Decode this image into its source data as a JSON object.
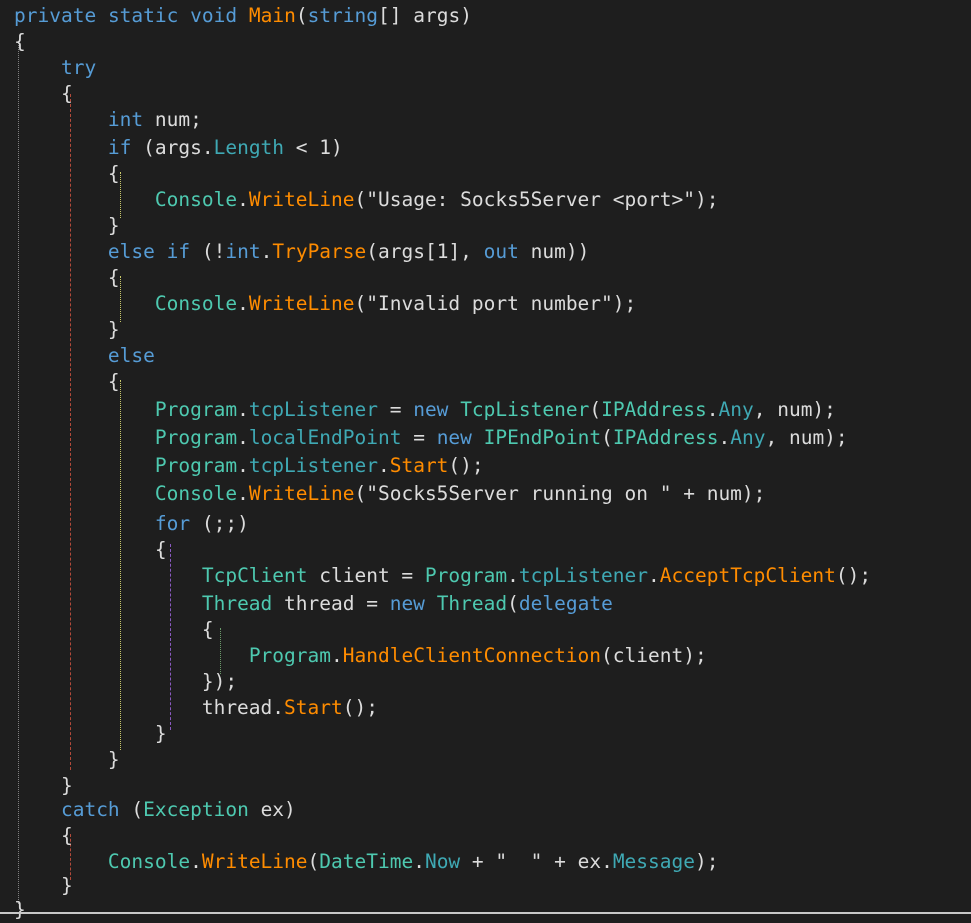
{
  "colors": {
    "background": "#1e1e1e",
    "keyword": "#569cd6",
    "type": "#4ec9b0",
    "method": "#ff8c00",
    "string": "#d69d85",
    "property": "#3fa9b4",
    "text": "#dcdcdc"
  },
  "code": {
    "lines": [
      [
        {
          "t": "private",
          "c": "kw"
        },
        {
          "t": " ",
          "c": "plain"
        },
        {
          "t": "static",
          "c": "kw"
        },
        {
          "t": " ",
          "c": "plain"
        },
        {
          "t": "void",
          "c": "kw"
        },
        {
          "t": " ",
          "c": "plain"
        },
        {
          "t": "Main",
          "c": "fn"
        },
        {
          "t": "(",
          "c": "plain"
        },
        {
          "t": "string",
          "c": "kw"
        },
        {
          "t": "[] args)",
          "c": "plain"
        }
      ],
      [
        {
          "t": "{",
          "c": "plain"
        }
      ],
      [
        {
          "t": "    ",
          "c": "plain"
        },
        {
          "t": "try",
          "c": "kw"
        }
      ],
      [
        {
          "t": "    {",
          "c": "plain"
        }
      ],
      [
        {
          "t": "        ",
          "c": "plain"
        },
        {
          "t": "int",
          "c": "kw"
        },
        {
          "t": " num;",
          "c": "plain"
        }
      ],
      [
        {
          "t": "        ",
          "c": "plain"
        },
        {
          "t": "if",
          "c": "kw"
        },
        {
          "t": " (args.",
          "c": "plain"
        },
        {
          "t": "Length",
          "c": "prop"
        },
        {
          "t": " < 1)",
          "c": "plain"
        }
      ],
      [
        {
          "t": "        {",
          "c": "plain"
        }
      ],
      [
        {
          "t": "            ",
          "c": "plain"
        },
        {
          "t": "Console",
          "c": "type"
        },
        {
          "t": ".",
          "c": "plain"
        },
        {
          "t": "WriteLine",
          "c": "fn"
        },
        {
          "t": "(\"Usage: Socks5Server <port>\");",
          "c": "plain"
        }
      ],
      [
        {
          "t": "        }",
          "c": "plain"
        }
      ],
      [
        {
          "t": "        ",
          "c": "plain"
        },
        {
          "t": "else",
          "c": "kw"
        },
        {
          "t": " ",
          "c": "plain"
        },
        {
          "t": "if",
          "c": "kw"
        },
        {
          "t": " (!",
          "c": "plain"
        },
        {
          "t": "int",
          "c": "kw"
        },
        {
          "t": ".",
          "c": "plain"
        },
        {
          "t": "TryParse",
          "c": "fn"
        },
        {
          "t": "(args[1], ",
          "c": "plain"
        },
        {
          "t": "out",
          "c": "kw"
        },
        {
          "t": " num))",
          "c": "plain"
        }
      ],
      [
        {
          "t": "        {",
          "c": "plain"
        }
      ],
      [
        {
          "t": "            ",
          "c": "plain"
        },
        {
          "t": "Console",
          "c": "type"
        },
        {
          "t": ".",
          "c": "plain"
        },
        {
          "t": "WriteLine",
          "c": "fn"
        },
        {
          "t": "(\"Invalid port number\");",
          "c": "plain"
        }
      ],
      [
        {
          "t": "        }",
          "c": "plain"
        }
      ],
      [
        {
          "t": "        ",
          "c": "plain"
        },
        {
          "t": "else",
          "c": "kw"
        }
      ],
      [
        {
          "t": "        {",
          "c": "plain"
        }
      ],
      [
        {
          "t": "            ",
          "c": "plain"
        },
        {
          "t": "Program",
          "c": "type"
        },
        {
          "t": ".",
          "c": "plain"
        },
        {
          "t": "tcpListener",
          "c": "prop"
        },
        {
          "t": " = ",
          "c": "plain"
        },
        {
          "t": "new",
          "c": "kw"
        },
        {
          "t": " ",
          "c": "plain"
        },
        {
          "t": "TcpListener",
          "c": "type"
        },
        {
          "t": "(",
          "c": "plain"
        },
        {
          "t": "IPAddress",
          "c": "type"
        },
        {
          "t": ".",
          "c": "plain"
        },
        {
          "t": "Any",
          "c": "prop"
        },
        {
          "t": ", num);",
          "c": "plain"
        }
      ],
      [
        {
          "t": "            ",
          "c": "plain"
        },
        {
          "t": "Program",
          "c": "type"
        },
        {
          "t": ".",
          "c": "plain"
        },
        {
          "t": "localEndPoint",
          "c": "prop"
        },
        {
          "t": " = ",
          "c": "plain"
        },
        {
          "t": "new",
          "c": "kw"
        },
        {
          "t": " ",
          "c": "plain"
        },
        {
          "t": "IPEndPoint",
          "c": "type"
        },
        {
          "t": "(",
          "c": "plain"
        },
        {
          "t": "IPAddress",
          "c": "type"
        },
        {
          "t": ".",
          "c": "plain"
        },
        {
          "t": "Any",
          "c": "prop"
        },
        {
          "t": ", num);",
          "c": "plain"
        }
      ],
      [
        {
          "t": "            ",
          "c": "plain"
        },
        {
          "t": "Program",
          "c": "type"
        },
        {
          "t": ".",
          "c": "plain"
        },
        {
          "t": "tcpListener",
          "c": "prop"
        },
        {
          "t": ".",
          "c": "plain"
        },
        {
          "t": "Start",
          "c": "fn"
        },
        {
          "t": "();",
          "c": "plain"
        }
      ],
      [
        {
          "t": "            ",
          "c": "plain"
        },
        {
          "t": "Console",
          "c": "type"
        },
        {
          "t": ".",
          "c": "plain"
        },
        {
          "t": "WriteLine",
          "c": "fn"
        },
        {
          "t": "(\"Socks5Server running on \" + num);",
          "c": "plain"
        }
      ],
      [
        {
          "t": "            ",
          "c": "plain"
        },
        {
          "t": "for",
          "c": "kw"
        },
        {
          "t": " (;;)",
          "c": "plain"
        }
      ],
      [
        {
          "t": "            {",
          "c": "plain"
        }
      ],
      [
        {
          "t": "                ",
          "c": "plain"
        },
        {
          "t": "TcpClient",
          "c": "type"
        },
        {
          "t": " client = ",
          "c": "plain"
        },
        {
          "t": "Program",
          "c": "type"
        },
        {
          "t": ".",
          "c": "plain"
        },
        {
          "t": "tcpListener",
          "c": "prop"
        },
        {
          "t": ".",
          "c": "plain"
        },
        {
          "t": "AcceptTcpClient",
          "c": "fn"
        },
        {
          "t": "();",
          "c": "plain"
        }
      ],
      [
        {
          "t": "                ",
          "c": "plain"
        },
        {
          "t": "Thread",
          "c": "type"
        },
        {
          "t": " thread = ",
          "c": "plain"
        },
        {
          "t": "new",
          "c": "kw"
        },
        {
          "t": " ",
          "c": "plain"
        },
        {
          "t": "Thread",
          "c": "type"
        },
        {
          "t": "(",
          "c": "plain"
        },
        {
          "t": "delegate",
          "c": "kw"
        }
      ],
      [
        {
          "t": "                {",
          "c": "plain"
        }
      ],
      [
        {
          "t": "                    ",
          "c": "plain"
        },
        {
          "t": "Program",
          "c": "type"
        },
        {
          "t": ".",
          "c": "plain"
        },
        {
          "t": "HandleClientConnection",
          "c": "fn"
        },
        {
          "t": "(client);",
          "c": "plain"
        }
      ],
      [
        {
          "t": "                });",
          "c": "plain"
        }
      ],
      [
        {
          "t": "                thread.",
          "c": "plain"
        },
        {
          "t": "Start",
          "c": "fn"
        },
        {
          "t": "();",
          "c": "plain"
        }
      ],
      [
        {
          "t": "            }",
          "c": "plain"
        }
      ],
      [
        {
          "t": "        }",
          "c": "plain"
        }
      ],
      [
        {
          "t": "    }",
          "c": "plain"
        }
      ],
      [
        {
          "t": "    ",
          "c": "plain"
        },
        {
          "t": "catch",
          "c": "kw"
        },
        {
          "t": " (",
          "c": "plain"
        },
        {
          "t": "Exception",
          "c": "type"
        },
        {
          "t": " ex)",
          "c": "plain"
        }
      ],
      [
        {
          "t": "    {",
          "c": "plain"
        }
      ],
      [
        {
          "t": "        ",
          "c": "plain"
        },
        {
          "t": "Console",
          "c": "type"
        },
        {
          "t": ".",
          "c": "plain"
        },
        {
          "t": "WriteLine",
          "c": "fn"
        },
        {
          "t": "(",
          "c": "plain"
        },
        {
          "t": "DateTime",
          "c": "type"
        },
        {
          "t": ".",
          "c": "plain"
        },
        {
          "t": "Now",
          "c": "prop"
        },
        {
          "t": " + \"  \" + ex.",
          "c": "plain"
        },
        {
          "t": "Message",
          "c": "prop"
        },
        {
          "t": ");",
          "c": "plain"
        }
      ],
      [
        {
          "t": "    }",
          "c": "plain"
        }
      ],
      [
        {
          "t": "}",
          "c": "plain"
        }
      ]
    ]
  }
}
